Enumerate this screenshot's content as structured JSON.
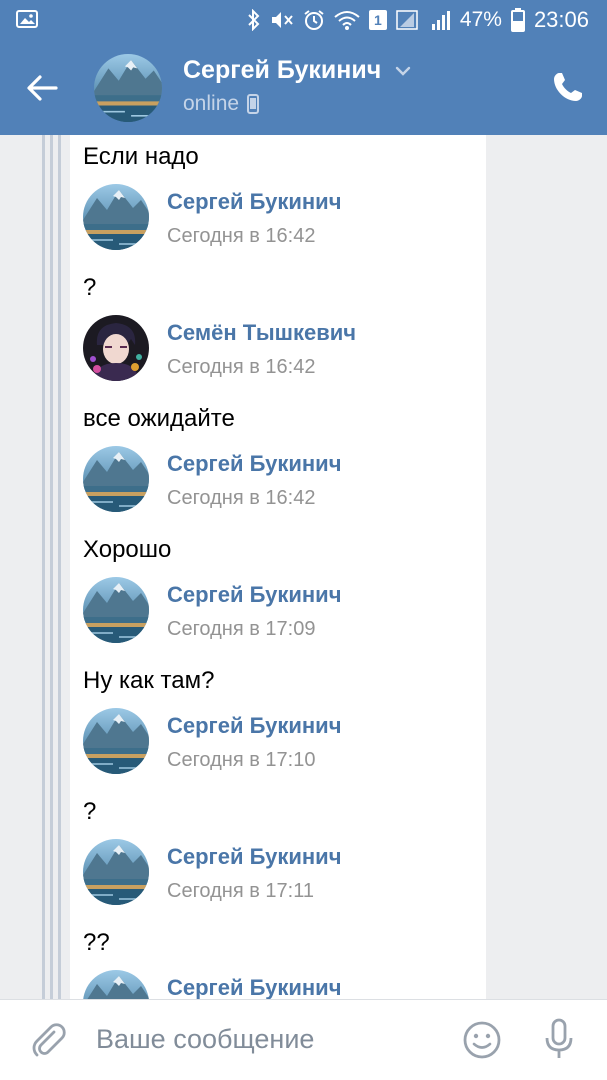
{
  "status_bar": {
    "battery_percent": "47%",
    "time": "23:06",
    "sim_badge": "1",
    "icons": [
      "image-icon",
      "bluetooth-icon",
      "mute-icon",
      "alarm-icon",
      "wifi-icon",
      "signal-icon",
      "battery-icon"
    ]
  },
  "header": {
    "contact_name": "Сергей Букинич",
    "status": "online",
    "back_icon": "arrow-left-icon",
    "call_icon": "phone-icon"
  },
  "messages": [
    {
      "kind": "text",
      "text": "Если надо"
    },
    {
      "kind": "author",
      "name": "Сергей Букинич",
      "time": "Сегодня в 16:42",
      "avatar": "mountain-lake"
    },
    {
      "kind": "text",
      "text": "?"
    },
    {
      "kind": "author",
      "name": "Семён Тышкевич",
      "time": "Сегодня в 16:42",
      "avatar": "anime-portrait"
    },
    {
      "kind": "text",
      "text": "все ожидайте"
    },
    {
      "kind": "author",
      "name": "Сергей Букинич",
      "time": "Сегодня в 16:42",
      "avatar": "mountain-lake"
    },
    {
      "kind": "text",
      "text": "Хорошо"
    },
    {
      "kind": "author",
      "name": "Сергей Букинич",
      "time": "Сегодня в 17:09",
      "avatar": "mountain-lake"
    },
    {
      "kind": "text",
      "text": "Ну как там?"
    },
    {
      "kind": "author",
      "name": "Сергей Букинич",
      "time": "Сегодня в 17:10",
      "avatar": "mountain-lake"
    },
    {
      "kind": "text",
      "text": "?"
    },
    {
      "kind": "author",
      "name": "Сергей Букинич",
      "time": "Сегодня в 17:11",
      "avatar": "mountain-lake"
    },
    {
      "kind": "text",
      "text": "??"
    },
    {
      "kind": "author",
      "name": "Сергей Букинич",
      "time": "",
      "avatar": "mountain-lake"
    }
  ],
  "composer": {
    "placeholder": "Ваше сообщение"
  },
  "colors": {
    "header_bg": "#5181b8",
    "author_name": "#4a76a8",
    "time_text": "#939393",
    "page_bg": "#edeef0"
  }
}
